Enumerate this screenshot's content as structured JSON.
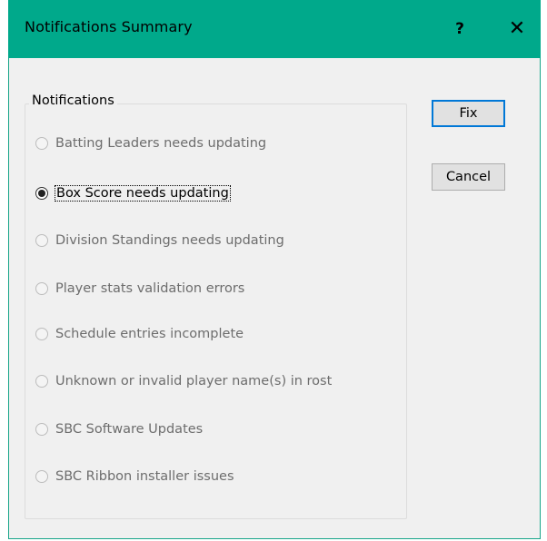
{
  "dialog": {
    "title": "Notifications Summary",
    "help_label": "?",
    "close_label": "✕",
    "title_color": "#00a98b"
  },
  "group": {
    "label": "Notifications",
    "options": [
      {
        "label": "Batting Leaders needs updating",
        "selected": false,
        "enabled": false
      },
      {
        "label": "Box Score needs updating",
        "selected": true,
        "enabled": true
      },
      {
        "label": "Division Standings needs updating",
        "selected": false,
        "enabled": false
      },
      {
        "label": "Player stats validation errors",
        "selected": false,
        "enabled": false
      },
      {
        "label": "Schedule entries incomplete",
        "selected": false,
        "enabled": false
      },
      {
        "label": "Unknown or invalid player name(s) in rost",
        "selected": false,
        "enabled": false
      },
      {
        "label": "SBC Software Updates",
        "selected": false,
        "enabled": false
      },
      {
        "label": "SBC Ribbon installer issues",
        "selected": false,
        "enabled": false
      }
    ]
  },
  "buttons": {
    "fix_label": "Fix",
    "cancel_label": "Cancel"
  }
}
